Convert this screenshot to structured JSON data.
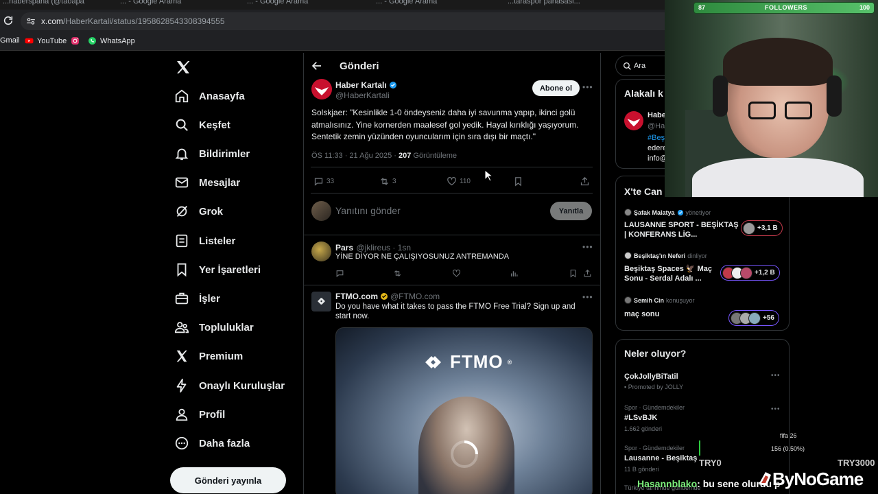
{
  "browser": {
    "tabs": [
      {
        "label": "...naberspana (@taoapa..."
      },
      {
        "label": "... - Google Arama"
      },
      {
        "label": "... - Google Arama"
      },
      {
        "label": "... - Google Arama"
      },
      {
        "label": "...taraspor panasasi..."
      }
    ],
    "url_domain": "x.com",
    "url_path": "/HaberKartali/status/1958628543308394555",
    "bookmarks": [
      {
        "label": "Gmail",
        "icon": "gmail-icon"
      },
      {
        "label": "YouTube",
        "icon": "youtube-icon",
        "color": "#ff0000"
      },
      {
        "label": "",
        "icon": "instagram-icon",
        "color": "#e1306c"
      },
      {
        "label": "WhatsApp",
        "icon": "whatsapp-icon",
        "color": "#25d366"
      }
    ]
  },
  "nav": {
    "items": [
      {
        "label": "Anasayfa",
        "icon": "home-icon"
      },
      {
        "label": "Keşfet",
        "icon": "search-icon"
      },
      {
        "label": "Bildirimler",
        "icon": "bell-icon"
      },
      {
        "label": "Mesajlar",
        "icon": "mail-icon"
      },
      {
        "label": "Grok",
        "icon": "grok-icon"
      },
      {
        "label": "Listeler",
        "icon": "list-icon"
      },
      {
        "label": "Yer İşaretleri",
        "icon": "bookmark-icon"
      },
      {
        "label": "İşler",
        "icon": "briefcase-icon"
      },
      {
        "label": "Topluluklar",
        "icon": "communities-icon"
      },
      {
        "label": "Premium",
        "icon": "x-icon"
      },
      {
        "label": "Onaylı Kuruluşlar",
        "icon": "lightning-icon"
      },
      {
        "label": "Profil",
        "icon": "person-icon"
      },
      {
        "label": "Daha fazla",
        "icon": "more-circle-icon"
      }
    ],
    "post_button": "Gönderi yayınla"
  },
  "post": {
    "page_title": "Gönderi",
    "author_name": "Haber Kartalı",
    "author_handle": "@HaberKartali",
    "follow_label": "Abone ol",
    "text": "Solskjaer: \"Kesinlikle 1-0 öndeyseniz daha iyi savunma yapıp, ikinci golü atmalısınız. Yine kornerden maalesef gol yedik. Hayal kırıklığı yaşıyorum. Sentetik zemin yüzünden oyuncularım için sıra dışı bir maçtı.\"",
    "time": "ÖS 11:33 · 21 Ağu 2025 · ",
    "views": "207",
    "views_label": "Görüntüleme",
    "replies": "33",
    "reposts": "3",
    "likes": "110",
    "reply_placeholder": "Yanıtını gönder",
    "reply_button": "Yanıtla"
  },
  "replies": [
    {
      "name": "Pars",
      "handle": "@jklireus · 1sn",
      "text": "YİNE DİYOR NE ÇALIŞIYOSUNUZ ANTREMANDA"
    }
  ],
  "ad": {
    "name": "FTMO.com",
    "handle": "@FTMO.com",
    "text": "Do you have what it takes to pass the FTMO Free Trial? Sign up and start now.",
    "image_brand": "FTMO",
    "image_brand_mark": "®"
  },
  "right": {
    "search_placeholder": "Ara",
    "related_title": "Alakalı k",
    "related_name": "Habe",
    "related_handle": "@Ha",
    "related_bio_1": "#Beş",
    "related_bio_2": "edere",
    "related_bio_3": "info@",
    "spaces_title": "X'te Can",
    "spaces": [
      {
        "host": "Şafak Malatya",
        "role": "yönetiyor",
        "title": "LAUSANNE SPORT - BEŞİKTAŞ | KONFERANS LİG...",
        "count": "+3,1 B"
      },
      {
        "host": "Beşiktaş'ın Neferi",
        "role": "dinliyor",
        "title": "Beşiktaş Spaces 🦅 Maç Sonu - Serdal Adalı ...",
        "count": "+1,2 B"
      },
      {
        "host": "Semih Cin",
        "role": "konuşuyor",
        "title": "maç sonu",
        "count": "+56"
      }
    ],
    "trends_title": "Neler oluyor?",
    "trends": [
      {
        "category": "",
        "name": "ÇokJollyBiTatil",
        "meta": "Promoted by JOLLY"
      },
      {
        "category": "Spor · Gündemdekiler",
        "name": "#LSvBJK",
        "meta": "1.662 gönderi"
      },
      {
        "category": "Spor · Gündemdekiler",
        "name": "Lausanne - Beşiktaş",
        "meta": "11 B gönderi"
      },
      {
        "category": "Türkiye tarihinde gündemde",
        "name": "",
        "meta": ""
      }
    ]
  },
  "overlay": {
    "followers_current": "87",
    "followers_label": "FOLLOWERS",
    "followers_goal": "100",
    "donation_title": "fifa 26",
    "donation_progress": "156 (0.50%)",
    "donation_min": "TRY0",
    "donation_max": "TRY3000",
    "chat_user": "Hasannblako",
    "chat_message": ": bu sene olurdu p",
    "brand": "ByNoGame"
  }
}
